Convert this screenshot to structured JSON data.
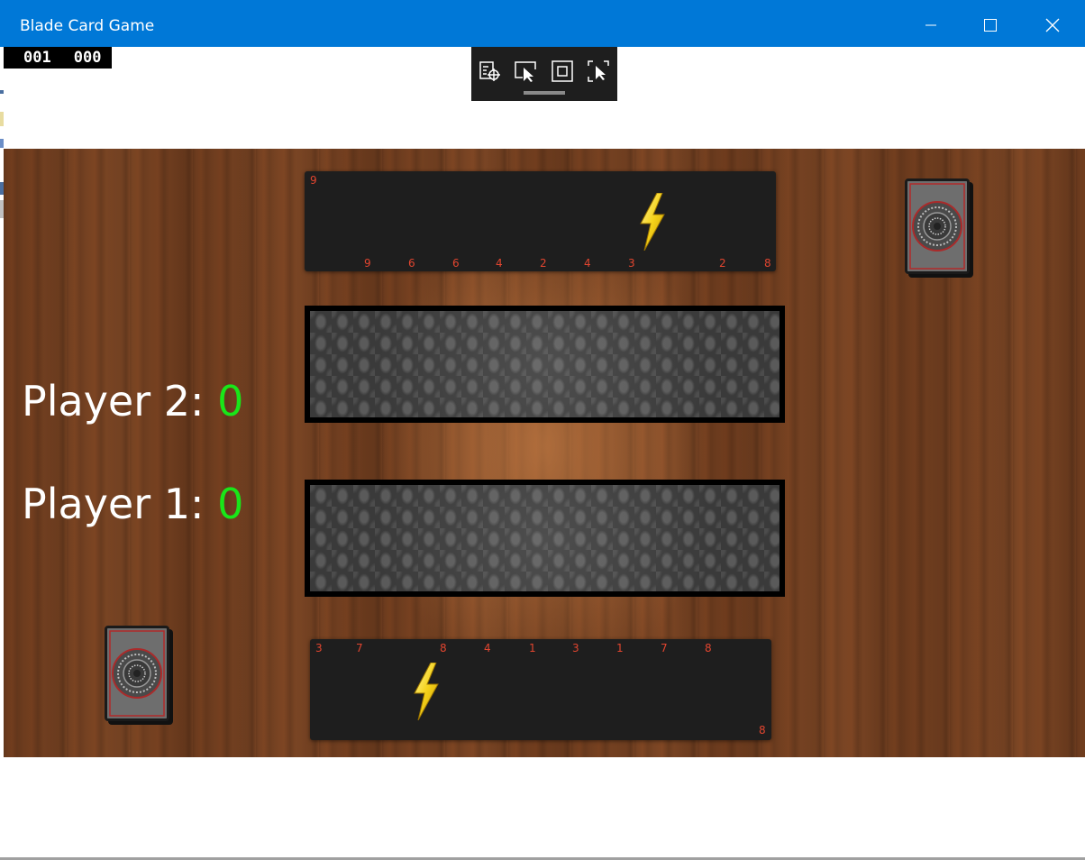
{
  "window": {
    "title": "Blade Card Game"
  },
  "counters": {
    "left": "001",
    "right": "000"
  },
  "debug_toolbar": {
    "buttons": [
      "live-visual-tree-icon",
      "select-element-icon",
      "display-layout-adorners-icon",
      "track-focused-element-icon"
    ]
  },
  "opponent_hand": {
    "corner_label": "9",
    "cards": [
      "9",
      "6",
      "6",
      "4",
      "2",
      "4",
      "3",
      "2",
      "8"
    ],
    "special_card": "lightning-bolt-icon"
  },
  "player_hand": {
    "cards": [
      "3",
      "7",
      "8",
      "4",
      "1",
      "3",
      "1",
      "7",
      "8"
    ],
    "corner_label": "8",
    "special_card": "lightning-bolt-icon"
  },
  "scores": {
    "player2": {
      "label": "Player 2:",
      "value": "0"
    },
    "player1": {
      "label": "Player 1:",
      "value": "0"
    }
  },
  "colors": {
    "title_bar": "#0078d7",
    "score_value": "#19e619",
    "card_number": "#e2452f",
    "hand_background": "#1e1e1e"
  }
}
